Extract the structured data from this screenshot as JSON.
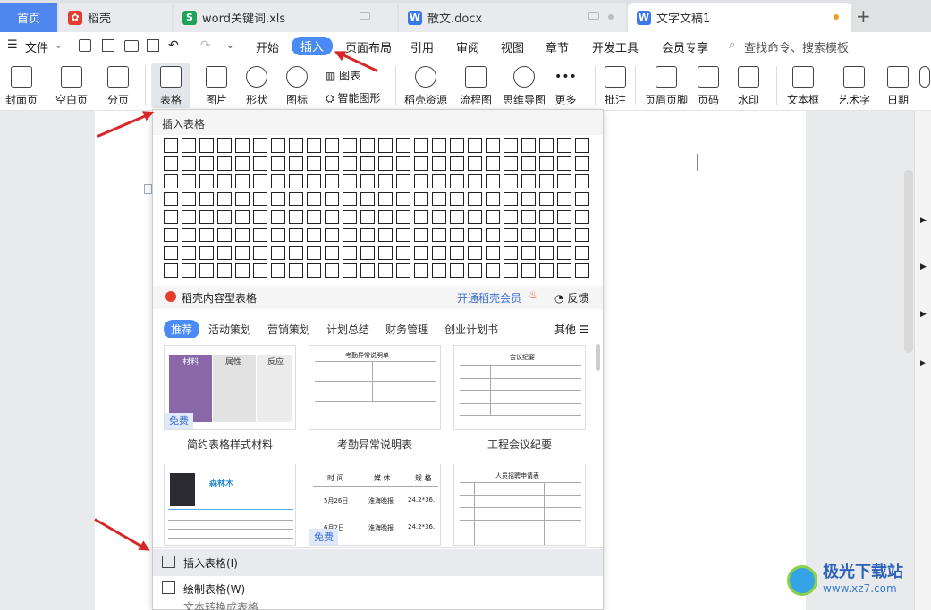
{
  "tabs": [
    {
      "label": "首页"
    },
    {
      "label": "稻壳",
      "icon": "daoke-icon"
    },
    {
      "label": "word关键词.xls",
      "icon": "spreadsheet-icon"
    },
    {
      "label": "散文.docx",
      "icon": "writer-icon"
    },
    {
      "label": "文字文稿1",
      "icon": "writer-icon"
    }
  ],
  "menu": {
    "file": "文件",
    "items": [
      "开始",
      "插入",
      "页面布局",
      "引用",
      "审阅",
      "视图",
      "章节",
      "开发工具",
      "会员专享"
    ],
    "search_placeholder": "查找命令、搜索模板"
  },
  "ribbon": {
    "cover": "封面页",
    "blank": "空白页",
    "pagebreak": "分页",
    "table": "表格",
    "picture": "图片",
    "shape": "形状",
    "icon": "图标",
    "chart": "图表",
    "smart": "智能图形",
    "daoke": "稻壳资源",
    "flow": "流程图",
    "mind": "思维导图",
    "more": "更多",
    "comment": "批注",
    "header": "页眉页脚",
    "pagenum": "页码",
    "watermark": "水印",
    "textbox": "文本框",
    "wordart": "艺术字",
    "date": "日期"
  },
  "popup": {
    "title": "插入表格",
    "grid": {
      "rows": 8,
      "cols": 24
    },
    "daoke_title": "稻壳内容型表格",
    "member": "开通稻壳会员",
    "feedback": "反馈",
    "categories": [
      "推荐",
      "活动策划",
      "营销策划",
      "计划总结",
      "财务管理",
      "创业计划书"
    ],
    "other": "其他",
    "templates": [
      {
        "label": "简约表格样式材料",
        "free": "免费",
        "cells": [
          "材料",
          "属性",
          "反应"
        ]
      },
      {
        "label": "考勤异常说明表",
        "title": "考勤异常说明单"
      },
      {
        "label": "工程会议纪要",
        "title": "会议纪要"
      },
      {
        "name": "森林木",
        "free": ""
      },
      {
        "cols": [
          "时 间",
          "媒 体",
          "规 格"
        ],
        "rows": [
          [
            "5月26日",
            "淮海晚报",
            "24.2*36."
          ],
          [
            "6月2日",
            "淮海晚报",
            "24.2*36."
          ]
        ],
        "free": "免费"
      },
      {
        "title": "人员招聘申请表"
      }
    ],
    "actions": [
      "插入表格(I)",
      "绘制表格(W)",
      "文本转换成表格"
    ]
  },
  "watermark": {
    "title": "极光下载站",
    "url": "www.xz7.com"
  }
}
